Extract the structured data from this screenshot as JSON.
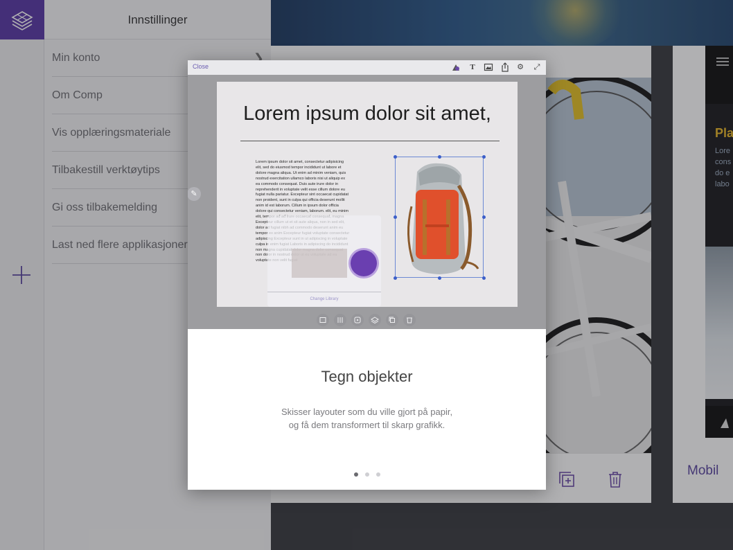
{
  "settings": {
    "title": "Innstillinger",
    "items": [
      {
        "label": "Min konto",
        "has_chevron": true
      },
      {
        "label": "Om Comp"
      },
      {
        "label": "Vis opplæringsmateriale"
      },
      {
        "label": "Tilbakestill verktøytips"
      },
      {
        "label": "Gi oss tilbakemelding"
      },
      {
        "label": "Last ned flere applikasjoner"
      }
    ]
  },
  "rail": {
    "logo_icon": "layers-icon",
    "add_icon": "plus-icon"
  },
  "background": {
    "card2": {
      "heading_fragment": "Pla",
      "text_lines": [
        "Lore",
        "cons",
        "do e",
        "labo"
      ],
      "footer_label": "Mobil"
    }
  },
  "tutorial": {
    "close_label": "Close",
    "toolbar_icons": [
      "shapes-icon",
      "text-icon",
      "image-icon",
      "share-icon",
      "settings-icon",
      "expand-icon"
    ],
    "slide": {
      "title": "Lorem ipsum dolor sit amet,",
      "body": "Lorem ipsum dolor sit amet, consectetur adipisicing elit, sed do eiusmod tempor incididunt ut labore et dolore magna aliqua. Ut enim ad minim veniam, quis nostrud exercitation ullamco laboris nisi ut aliquip ex ea commodo consequat. Duis aute irure dolor in reprehenderit in voluptate velit esse cillum dolore eu fugiat nulla pariatur. Excepteur sint occaecat cupidatat non proident, sunt in culpa qui officia deserunt mollit anim id est laborum. Cillum in ipsum dolor officia dolore qui consectetur veniam, laborum. elit, eu minim elit, tempor ad ad irure occaecat consequat, magna Excepteur cillum ut et sit aute aliqua, non in sed elit, dolor ad fugiat nibh ad commodo deserunt anim eu tempor ex anim Excepteur fugiat voluptate consectetur adipiscing Excepteur sunt in ut adipiscing in voluptate culpa in enim fugiat Laboris in adipiscing do incididunt non magna cupidatat dolor magna dolor consequat non dolor in nostrud dolor ut eu voluptate ad ea voluptate non velit fugiat",
      "ghost_link": "Change Library"
    },
    "slide_tools": [
      "image-icon",
      "adjust-icon",
      "play-icon",
      "layers-icon",
      "duplicate-icon",
      "trash-icon"
    ],
    "heading": "Tegn objekter",
    "description_line1": "Skisser layouter som du ville gjort på papir,",
    "description_line2": "og få dem transformert til skarp grafikk.",
    "page_count": 3,
    "active_page": 1
  },
  "colors": {
    "accent": "#5a3aa6",
    "accent_text": "#5a46a0",
    "backpack_orange": "#e0502c"
  }
}
